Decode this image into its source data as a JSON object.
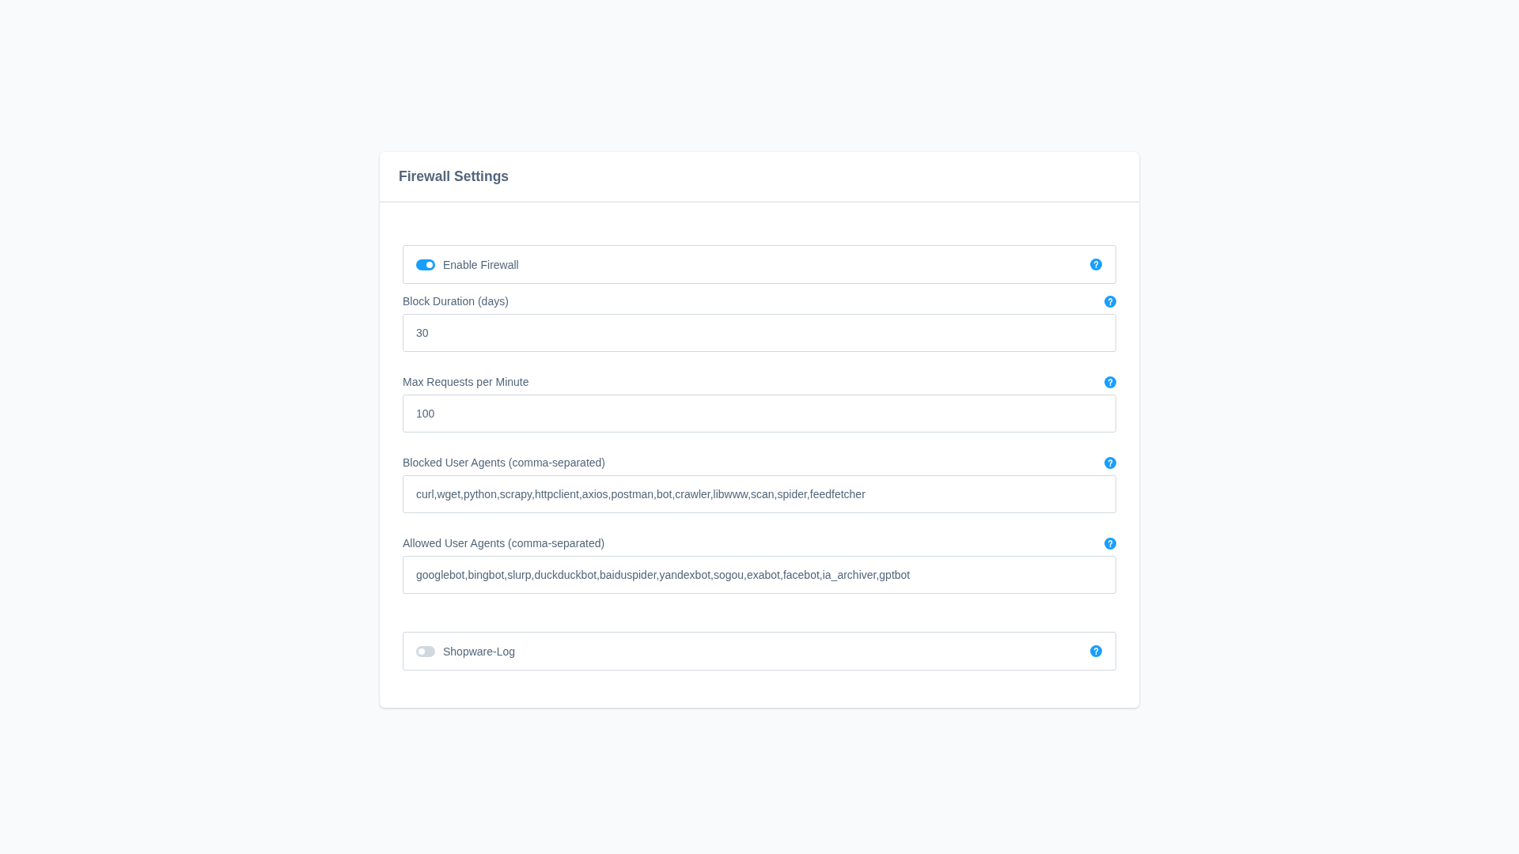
{
  "card": {
    "title": "Firewall Settings"
  },
  "settings": [
    {
      "kind": "toggle",
      "label": "Enable Firewall",
      "on": true
    },
    {
      "kind": "input",
      "label": "Block Duration (days)",
      "value": "30"
    },
    {
      "kind": "input",
      "label": "Max Requests per Minute",
      "value": "100"
    },
    {
      "kind": "input",
      "label": "Blocked User Agents (comma-separated)",
      "value": "curl,wget,python,scrapy,httpclient,axios,postman,bot,crawler,libwww,scan,spider,feedfetcher"
    },
    {
      "kind": "input",
      "label": "Allowed User Agents (comma-separated)",
      "value": "googlebot,bingbot,slurp,duckduckbot,baiduspider,yandexbot,sogou,exabot,facebot,ia_archiver,gptbot"
    },
    {
      "kind": "toggle",
      "label": "Shopware-Log",
      "on": false
    }
  ]
}
